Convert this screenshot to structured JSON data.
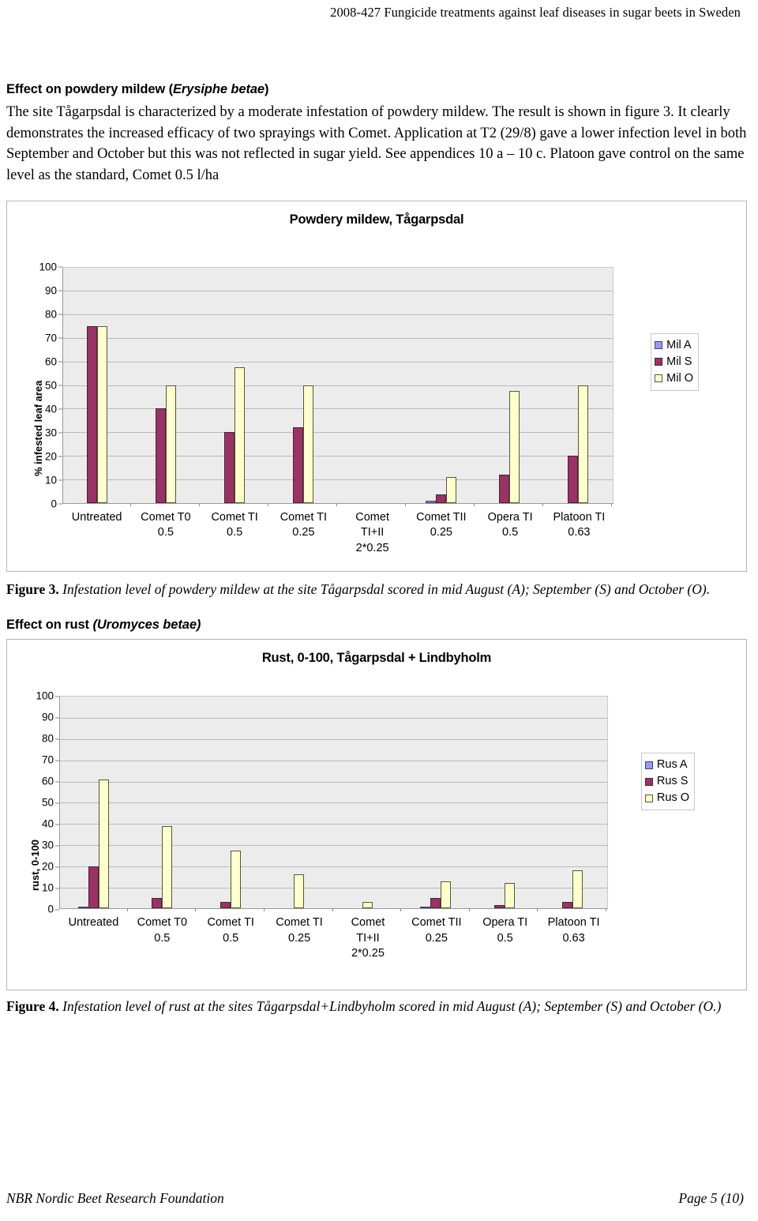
{
  "header": {
    "running_title": "2008-427 Fungicide treatments against leaf diseases in sugar beets in Sweden"
  },
  "sections": {
    "mildew_heading_plain": "Effect on powdery mildew (",
    "mildew_heading_italic": "Erysiphe betae",
    "mildew_heading_close": ")",
    "mildew_paragraph": "The site Tågarpsdal is characterized by a moderate infestation of powdery mildew. The result is shown in figure 3. It clearly demonstrates the increased efficacy of two sprayings with Comet. Application at T2 (29/8) gave a lower infection level in both September and October but this was not reflected in sugar yield. See appendices 10 a – 10 c. Platoon gave control on the same level as the standard, Comet 0.5 l/ha",
    "rust_heading_plain": "Effect on rust ",
    "rust_heading_italic": "(Uromyces betae)",
    "figure3_label": "Figure 3.",
    "figure3_caption": " Infestation level of powdery mildew at the site Tågarpsdal scored in mid August (A); September (S) and October (O).",
    "figure4_label": "Figure 4.",
    "figure4_caption": " Infestation level of rust at the sites Tågarpsdal+Lindbyholm scored in mid August (A); September (S) and October (O.)"
  },
  "footer": {
    "organisation": "NBR Nordic Beet Research Foundation",
    "page": "Page 5 (10)"
  },
  "colors": {
    "series_a": "#9999ff",
    "series_s": "#993366",
    "series_o": "#ffffcc",
    "plot_background": "#ececec",
    "gridline": "#b9b9b9"
  },
  "chart_data": [
    {
      "id": "powdery-mildew-chart",
      "type": "bar",
      "title": "Powdery mildew, Tågarpsdal",
      "xlabel": "",
      "ylabel": "% infested leaf area",
      "ylim": [
        0,
        100
      ],
      "yticks": [
        0,
        10,
        20,
        30,
        40,
        50,
        60,
        70,
        80,
        90,
        100
      ],
      "ticklabels": [
        "0",
        "10",
        "20",
        "30",
        "40",
        "50",
        "60",
        "70",
        "80",
        "90",
        "100"
      ],
      "grid": true,
      "legend_position": "right",
      "categories": [
        [
          "Untreated",
          "",
          ""
        ],
        [
          "Comet T0",
          "0.5",
          ""
        ],
        [
          "Comet TI",
          "0.5",
          ""
        ],
        [
          "Comet TI",
          "0.25",
          ""
        ],
        [
          "Comet",
          "TI+II",
          "2*0.25"
        ],
        [
          "Comet TII",
          "0.25",
          ""
        ],
        [
          "Opera TI",
          "0.5",
          ""
        ],
        [
          "Platoon TI",
          "0.63",
          ""
        ]
      ],
      "series": [
        {
          "name": "Mil A",
          "color": "#9999ff",
          "values": [
            0,
            0,
            0,
            0,
            0,
            1,
            0,
            0
          ]
        },
        {
          "name": "Mil S",
          "color": "#993366",
          "values": [
            75,
            40,
            30,
            32,
            0,
            3.5,
            12,
            20
          ]
        },
        {
          "name": "Mil O",
          "color": "#ffffcc",
          "values": [
            75,
            50,
            57.5,
            50,
            0,
            11,
            47.5,
            50
          ]
        }
      ]
    },
    {
      "id": "rust-chart",
      "type": "bar",
      "title": "Rust, 0-100, Tågarpsdal + Lindbyholm",
      "xlabel": "",
      "ylabel": "rust, 0-100",
      "ylim": [
        0,
        100
      ],
      "yticks": [
        0,
        10,
        20,
        30,
        40,
        50,
        60,
        70,
        80,
        90,
        100
      ],
      "ticklabels": [
        "0",
        "10",
        "20",
        "30",
        "40",
        "50",
        "60",
        "70",
        "80",
        "90",
        "100"
      ],
      "grid": true,
      "legend_position": "right",
      "categories": [
        [
          "Untreated",
          "",
          ""
        ],
        [
          "Comet T0",
          "0.5",
          ""
        ],
        [
          "Comet TI",
          "0.5",
          ""
        ],
        [
          "Comet TI",
          "0.25",
          ""
        ],
        [
          "Comet",
          "TI+II",
          "2*0.25"
        ],
        [
          "Comet TII",
          "0.25",
          ""
        ],
        [
          "Opera TI",
          "0.5",
          ""
        ],
        [
          "Platoon TI",
          "0.63",
          ""
        ]
      ],
      "series": [
        {
          "name": "Rus A",
          "color": "#9999ff",
          "values": [
            1,
            0,
            0,
            0,
            0,
            0.8,
            0,
            0
          ]
        },
        {
          "name": "Rus S",
          "color": "#993366",
          "values": [
            20,
            5,
            3,
            0,
            0,
            5,
            1.5,
            3
          ]
        },
        {
          "name": "Rus O",
          "color": "#ffffcc",
          "values": [
            61,
            39,
            27.5,
            16,
            3,
            13,
            12,
            18
          ]
        }
      ]
    }
  ]
}
